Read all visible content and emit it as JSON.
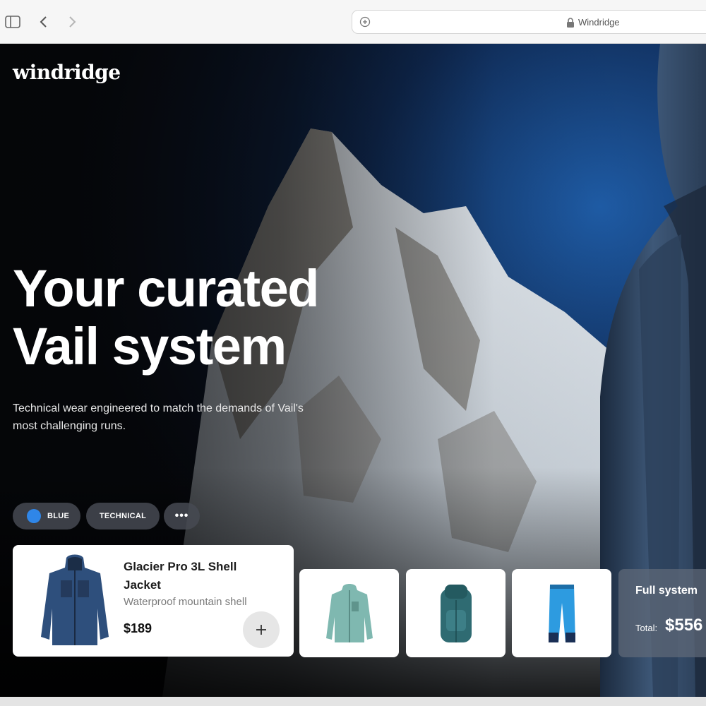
{
  "browser": {
    "url_text": "Windridge",
    "icons": [
      "sidebar-icon",
      "back-icon",
      "forward-icon",
      "site-info-icon",
      "lock-icon"
    ]
  },
  "brand": {
    "logo": "windridge"
  },
  "hero": {
    "headline_line1": "Your curated",
    "headline_line2": "Vail system",
    "subtext": "Technical wear engineered to match the demands of Vail's most challenging runs."
  },
  "filters": {
    "blue_label": "BLUE",
    "technical_label": "TECHNICAL",
    "more_label": "•••",
    "blue_color": "#2f86e8"
  },
  "featured_product": {
    "name": "Glacier Pro 3L Shell Jacket",
    "description": "Waterproof mountain shell",
    "price": "$189",
    "add_label": "+"
  },
  "other_products": [
    {
      "icon": "fleece-jacket-icon",
      "color": "#7fb8b0"
    },
    {
      "icon": "backpack-icon",
      "color": "#2f6b72"
    },
    {
      "icon": "ski-pants-icon",
      "color": "#2d9be0"
    }
  ],
  "summary": {
    "title": "Full system",
    "total_label": "Total:",
    "total_value": "$556"
  }
}
